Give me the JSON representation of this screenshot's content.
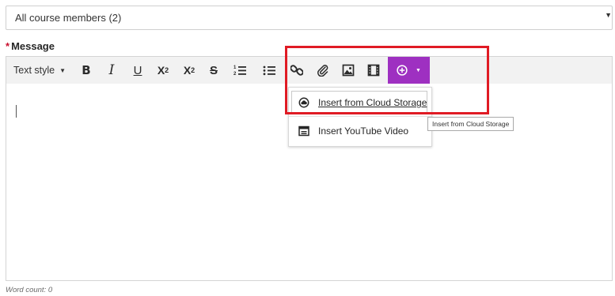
{
  "recipients": {
    "value": "All course members (2)"
  },
  "message": {
    "required_marker": "*",
    "label": "Message"
  },
  "toolbar": {
    "text_style": "Text style",
    "bold": "B",
    "italic": "I",
    "underline": "U",
    "superscript_base": "X",
    "superscript_mark": "2",
    "subscript_base": "X",
    "subscript_mark": "2",
    "strikethrough": "S"
  },
  "insert_menu": {
    "items": [
      {
        "label": "Insert from Cloud Storage",
        "icon": "cloud-upload-icon"
      },
      {
        "label": "Insert YouTube Video",
        "icon": "video-window-icon"
      }
    ]
  },
  "tooltip": {
    "text": "Insert from Cloud Storage"
  },
  "footer": {
    "word_count": "Word count: 0"
  },
  "colors": {
    "accent": "#9e30c1",
    "highlight": "#e01b24",
    "required": "#c8102e"
  }
}
